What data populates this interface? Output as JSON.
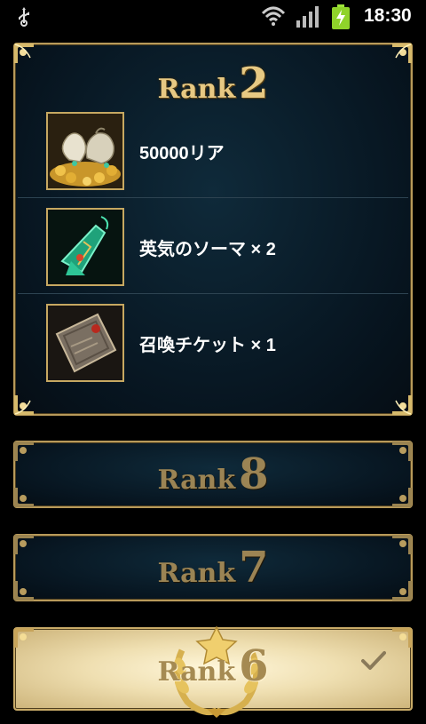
{
  "status_bar": {
    "time": "18:30",
    "icons": [
      "usb-icon",
      "wifi-icon",
      "signal-icon",
      "battery-charging-icon"
    ]
  },
  "ranks": {
    "open": {
      "word": "Rank",
      "number": "2",
      "rewards": [
        {
          "icon": "money-bags-icon",
          "label": "50000リア"
        },
        {
          "icon": "potion-bottle-icon",
          "label": "英気のソーマ × 2"
        },
        {
          "icon": "summon-ticket-icon",
          "label": "召喚チケット × 1"
        }
      ]
    },
    "r8": {
      "word": "Rank",
      "number": "8"
    },
    "r7": {
      "word": "Rank",
      "number": "7"
    },
    "r6": {
      "word": "Rank",
      "number": "6",
      "achieved": true
    }
  },
  "colors": {
    "gold": "#e7c983",
    "panel_bg": "#071520",
    "achieved_bg": "#efdfb1"
  }
}
